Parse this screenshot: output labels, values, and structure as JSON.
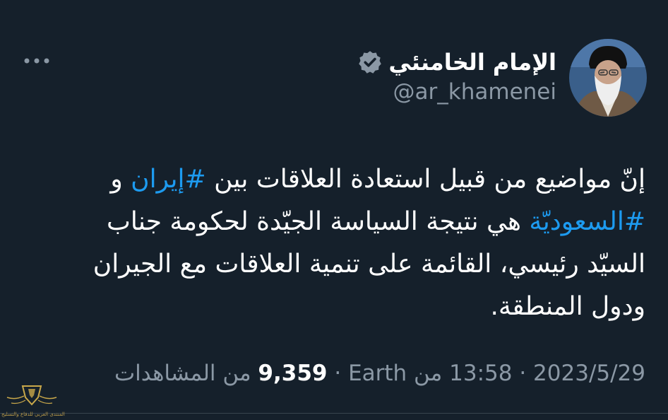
{
  "tweet": {
    "author": {
      "display_name": "الإمام الخامنئي",
      "handle": "@ar_khamenei",
      "verified_icon": "verified-badge-icon"
    },
    "body": {
      "part1": "إنّ مواضيع من قبيل استعادة العلاقات بين ",
      "hashtag1": "#إيران",
      "part2": " و ",
      "hashtag2": "#السعوديّة",
      "part3": " هي نتيجة السياسة الجيّدة لحكومة جناب السيّد رئيسي، القائمة على تنمية العلاقات مع الجيران ودول المنطقة."
    },
    "meta": {
      "date": "2023/5/29",
      "separator": "·",
      "time": "13:58",
      "source": "من Earth",
      "views_count": "9,359",
      "views_label": "من المشاهدات"
    },
    "more_icon": "more-horizontal-icon"
  },
  "watermark": {
    "text": "المنتدى العربي للدفاع والتسليح"
  },
  "colors": {
    "background": "#15202b",
    "text": "#ffffff",
    "secondary": "#8b98a5",
    "hashtag": "#1d9bf0",
    "verified_badge": "#8b98a5"
  }
}
